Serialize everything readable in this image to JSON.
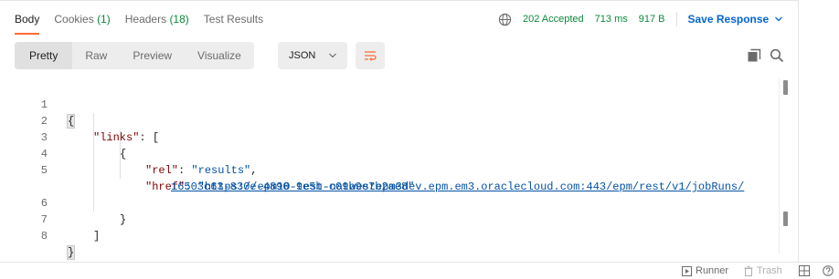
{
  "tabs": [
    {
      "label": "Body",
      "count": ""
    },
    {
      "label": "Cookies",
      "count": "(1)"
    },
    {
      "label": "Headers",
      "count": "(18)"
    },
    {
      "label": "Test Results",
      "count": ""
    }
  ],
  "meta": {
    "status": "202 Accepted",
    "time": "713 ms",
    "size": "917 B",
    "save_label": "Save Response"
  },
  "view_options": [
    "Pretty",
    "Raw",
    "Preview",
    "Visualize"
  ],
  "format_select": "JSON",
  "code": {
    "line_numbers": [
      "1",
      "2",
      "3",
      "4",
      "5",
      "6",
      "7",
      "8"
    ],
    "open_brace": "{",
    "close_brace": "}",
    "links_key": "\"links\"",
    "links_colon": ": [",
    "inner_open": "{",
    "rel_key": "\"rel\"",
    "rel_sep": ": ",
    "rel_value": "\"results\"",
    "rel_comma": ",",
    "href_key": "\"href\"",
    "href_sep": ": \"",
    "href_url_part1": "https://epm10-test-natwestepm3dev.epm.em3.oraclecloud.com:443/epm/rest/v1/jobRuns/",
    "href_url_part2": "16503c63-830e-4890-9e5b-c09b9e7b2ae8",
    "href_end_quote": "\"",
    "inner_close": "}",
    "array_close": "]"
  },
  "statusbar": {
    "runner": "Runner",
    "trash": "Trash"
  },
  "colors": {
    "accent": "#ff6c37",
    "success": "#0a8a3a",
    "link": "#0265d2"
  }
}
